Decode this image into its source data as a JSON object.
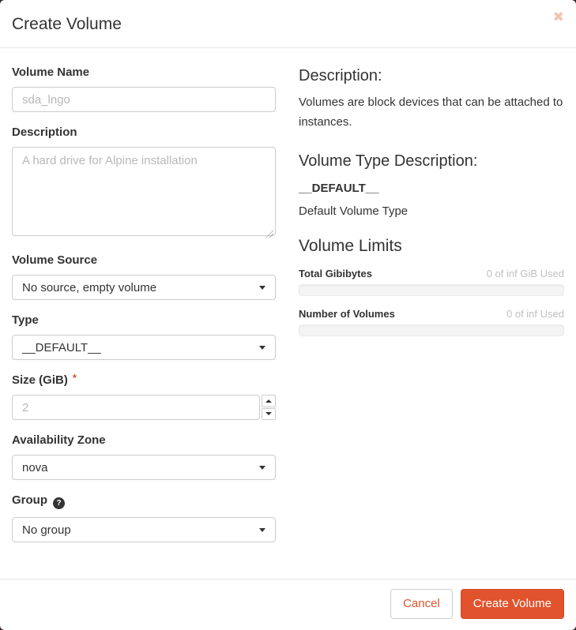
{
  "modal": {
    "title": "Create Volume",
    "close_icon": "✖"
  },
  "form": {
    "volume_name": {
      "label": "Volume Name",
      "placeholder": "sda_lngo"
    },
    "description": {
      "label": "Description",
      "placeholder": "A hard drive for Alpine installation"
    },
    "volume_source": {
      "label": "Volume Source",
      "value": "No source, empty volume"
    },
    "type": {
      "label": "Type",
      "value": "__DEFAULT__"
    },
    "size": {
      "label": "Size (GiB)",
      "required_marker": "*",
      "placeholder": "2"
    },
    "availability_zone": {
      "label": "Availability Zone",
      "value": "nova"
    },
    "group": {
      "label": "Group",
      "help_icon": "?",
      "value": "No group"
    }
  },
  "info": {
    "description_heading": "Description:",
    "description_text": "Volumes are block devices that can be attached to instances.",
    "type_description_heading": "Volume Type Description:",
    "type_name": "__DEFAULT__",
    "type_description": "Default Volume Type",
    "limits": {
      "heading": "Volume Limits",
      "items": [
        {
          "label": "Total Gibibytes",
          "usage": "0 of inf GiB Used",
          "percent": 0
        },
        {
          "label": "Number of Volumes",
          "usage": "0 of inf Used",
          "percent": 0
        }
      ]
    }
  },
  "footer": {
    "cancel_label": "Cancel",
    "submit_label": "Create Volume"
  },
  "colors": {
    "primary": "#e0532d",
    "close_icon": "#f4c3b1"
  }
}
